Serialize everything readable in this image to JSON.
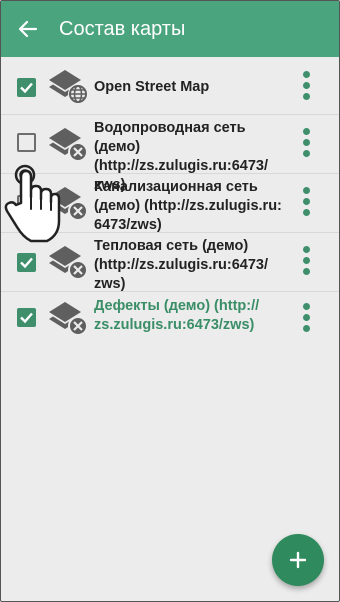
{
  "appbar": {
    "title": "Состав карты",
    "back_icon": "arrow-left-icon"
  },
  "layers": [
    {
      "label": "Open Street Map",
      "checked": true,
      "icon": "layer-globe-icon",
      "highlight": false
    },
    {
      "label": "Водопроводная сеть (демо) (http://zs.zulugis.ru:6473/ zws)",
      "checked": false,
      "icon": "layer-cross-icon",
      "highlight": false
    },
    {
      "label": "Канализационная сеть (демо) (http://zs.zulugis.ru: 6473/zws)",
      "checked": false,
      "icon": "layer-cross-icon",
      "highlight": false
    },
    {
      "label": "Тепловая сеть (демо) (http://zs.zulugis.ru:6473/ zws)",
      "checked": true,
      "icon": "layer-cross-icon",
      "highlight": false
    },
    {
      "label": "Дефекты (демо) (http:// zs.zulugis.ru:6473/zws)",
      "checked": true,
      "icon": "layer-cross-icon",
      "highlight": true
    }
  ],
  "fab": {
    "icon": "plus-icon"
  },
  "colors": {
    "appbar": "#4aa47e",
    "accent": "#3f8f6c",
    "fab": "#2f8a5e",
    "background": "#ececec"
  }
}
